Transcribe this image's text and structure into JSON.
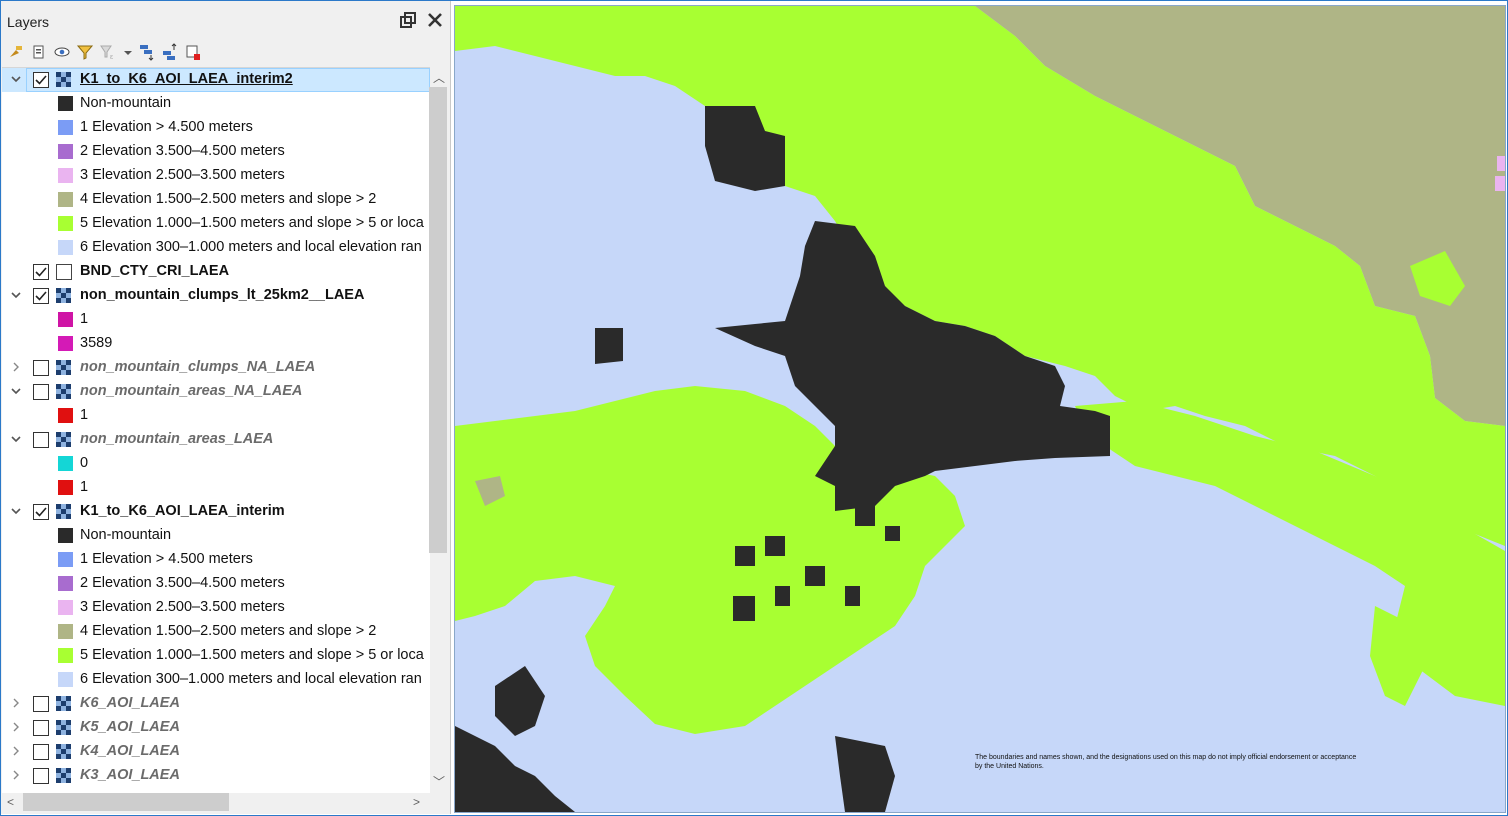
{
  "panel": {
    "title": "Layers",
    "float_icon": "restore-window-icon",
    "close_icon": "close-icon",
    "toolbar_icons": [
      "style-manager-icon",
      "add-group-icon",
      "manage-visibility-icon",
      "filter-legend-icon",
      "filter-expression-icon",
      "dropdown-arrow-icon",
      "expand-all-icon",
      "collapse-all-icon",
      "remove-layer-icon"
    ]
  },
  "tree": [
    {
      "kind": "layer",
      "name": "K1_to_K6_AOI_LAEA_interim2",
      "checked": true,
      "expanded": true,
      "selected": true,
      "visible": true,
      "icon": "raster"
    },
    {
      "kind": "item",
      "label": "Non-mountain",
      "color": "#2a2a2a"
    },
    {
      "kind": "item",
      "label": "1 Elevation > 4.500 meters",
      "color": "#7b9cf5"
    },
    {
      "kind": "item",
      "label": "2 Elevation 3.500–4.500 meters",
      "color": "#a86ccf"
    },
    {
      "kind": "item",
      "label": "3 Elevation 2.500–3.500 meters",
      "color": "#eab4f0"
    },
    {
      "kind": "item",
      "label": "4 Elevation 1.500–2.500 meters and slope > 2",
      "color": "#afb586"
    },
    {
      "kind": "item",
      "label": "5 Elevation 1.000–1.500 meters and slope > 5 or loca",
      "color": "#a8ff32"
    },
    {
      "kind": "item",
      "label": "6 Elevation 300–1.000 meters and local elevation ran",
      "color": "#c6d7f9"
    },
    {
      "kind": "layer",
      "name": "BND_CTY_CRI_LAEA",
      "checked": true,
      "expanded": null,
      "selected": false,
      "visible": true,
      "icon": "polygon"
    },
    {
      "kind": "layer",
      "name": "non_mountain_clumps_lt_25km2__LAEA",
      "checked": true,
      "expanded": true,
      "selected": false,
      "visible": true,
      "icon": "raster"
    },
    {
      "kind": "item",
      "label": "1",
      "color": "#cf14a5"
    },
    {
      "kind": "item",
      "label": "3589",
      "color": "#d41ab6"
    },
    {
      "kind": "layer",
      "name": "non_mountain_clumps_NA_LAEA",
      "checked": false,
      "expanded": false,
      "selected": false,
      "visible": false,
      "icon": "raster"
    },
    {
      "kind": "layer",
      "name": "non_mountain_areas_NA_LAEA",
      "checked": false,
      "expanded": true,
      "selected": false,
      "visible": false,
      "icon": "raster"
    },
    {
      "kind": "item",
      "label": "1",
      "color": "#e01010"
    },
    {
      "kind": "layer",
      "name": "non_mountain_areas_LAEA",
      "checked": false,
      "expanded": true,
      "selected": false,
      "visible": false,
      "icon": "raster"
    },
    {
      "kind": "item",
      "label": "0",
      "color": "#14d6d6"
    },
    {
      "kind": "item",
      "label": "1",
      "color": "#e01010"
    },
    {
      "kind": "layer",
      "name": "K1_to_K6_AOI_LAEA_interim",
      "checked": true,
      "expanded": true,
      "selected": false,
      "visible": true,
      "icon": "raster"
    },
    {
      "kind": "item",
      "label": "Non-mountain",
      "color": "#2a2a2a"
    },
    {
      "kind": "item",
      "label": "1 Elevation > 4.500 meters",
      "color": "#7b9cf5"
    },
    {
      "kind": "item",
      "label": "2 Elevation 3.500–4.500 meters",
      "color": "#a86ccf"
    },
    {
      "kind": "item",
      "label": "3 Elevation 2.500–3.500 meters",
      "color": "#eab4f0"
    },
    {
      "kind": "item",
      "label": "4 Elevation 1.500–2.500 meters and slope > 2",
      "color": "#afb586"
    },
    {
      "kind": "item",
      "label": "5 Elevation 1.000–1.500 meters and slope > 5 or loca",
      "color": "#a8ff32"
    },
    {
      "kind": "item",
      "label": "6 Elevation 300–1.000 meters and local elevation ran",
      "color": "#c6d7f9"
    },
    {
      "kind": "layer",
      "name": "K6_AOI_LAEA",
      "checked": false,
      "expanded": false,
      "selected": false,
      "visible": false,
      "icon": "raster"
    },
    {
      "kind": "layer",
      "name": "K5_AOI_LAEA",
      "checked": false,
      "expanded": false,
      "selected": false,
      "visible": false,
      "icon": "raster"
    },
    {
      "kind": "layer",
      "name": "K4_AOI_LAEA",
      "checked": false,
      "expanded": false,
      "selected": false,
      "visible": false,
      "icon": "raster"
    },
    {
      "kind": "layer",
      "name": "K3_AOI_LAEA",
      "checked": false,
      "expanded": false,
      "selected": false,
      "visible": false,
      "icon": "raster"
    }
  ],
  "map": {
    "disclaimer": "The boundaries and names shown, and the designations used on this map do not imply official endorsement or acceptance by the United Nations.",
    "colors": {
      "background": "#c6d7f9",
      "green": "#a8ff32",
      "tan": "#afb586",
      "dark": "#2a2a2a",
      "pink": "#eab4f0"
    }
  }
}
